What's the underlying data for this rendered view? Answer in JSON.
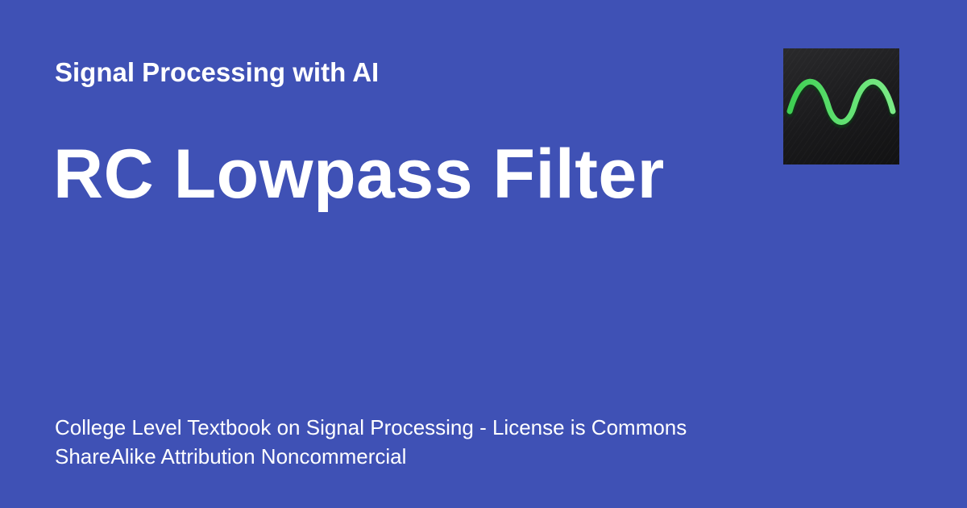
{
  "header": {
    "site_name": "Signal Processing with AI"
  },
  "main": {
    "title": "RC Lowpass Filter",
    "description": "College Level Textbook on Signal Processing - License is Commons ShareAlike Attribution Noncommercial"
  },
  "logo": {
    "icon": "sine-wave-icon",
    "wave_color": "#4cd964",
    "background_color": "#1c1c1e"
  },
  "theme": {
    "background_color": "#3f51b5",
    "text_color": "#ffffff"
  }
}
